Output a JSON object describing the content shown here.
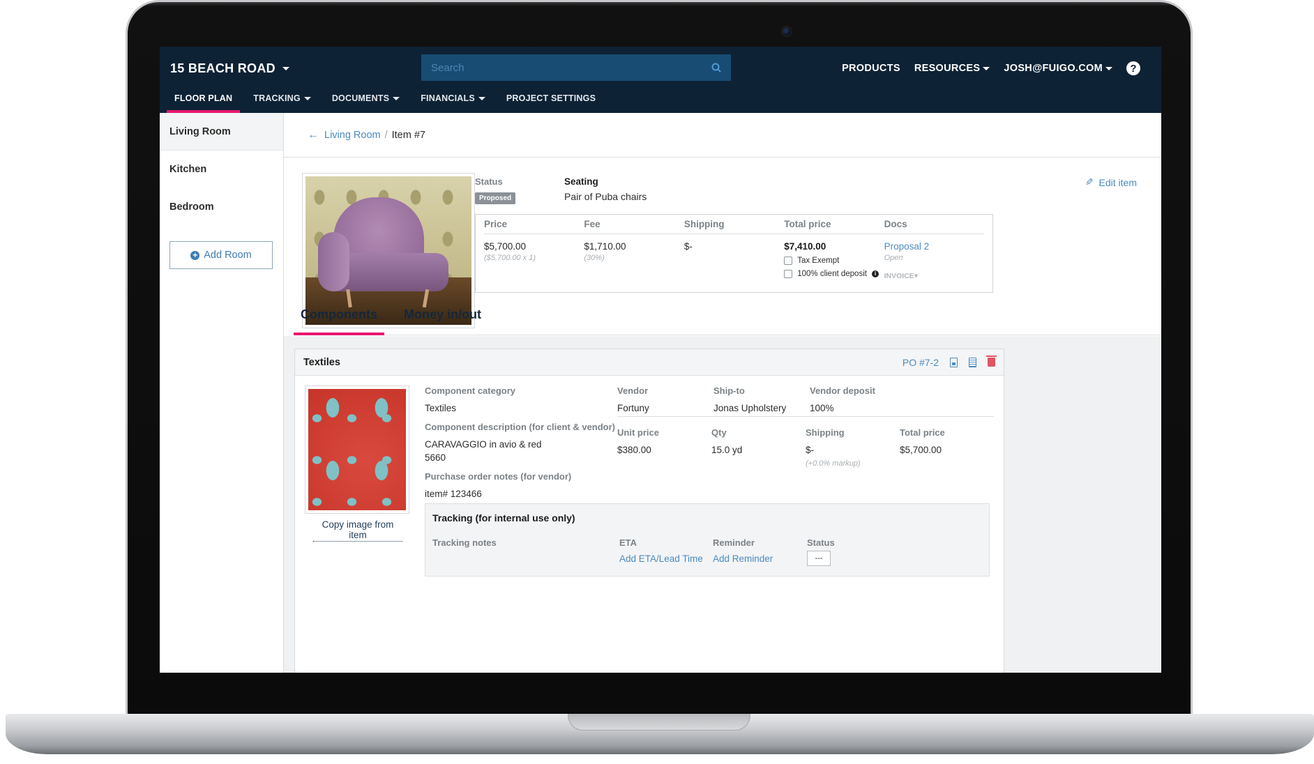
{
  "app": {
    "project_name": "15 BEACH ROAD",
    "search_placeholder": "Search",
    "top_nav": [
      "PRODUCTS",
      "RESOURCES",
      "JOSH@FUIGO.COM"
    ],
    "help": "?"
  },
  "subnav": {
    "tabs": [
      "FLOOR PLAN",
      "TRACKING",
      "DOCUMENTS",
      "FINANCIALS",
      "PROJECT SETTINGS"
    ],
    "active": "FLOOR PLAN"
  },
  "sidebar": {
    "rooms": [
      "Living Room",
      "Kitchen",
      "Bedroom"
    ],
    "active_room": "Living Room",
    "add_room": "Add Room"
  },
  "breadcrumb": {
    "parent": "Living Room",
    "sep": "/",
    "current": "Item #7"
  },
  "item": {
    "status_label": "Status",
    "status_value": "Proposed",
    "category": "Seating",
    "description": "Pair of Puba chairs",
    "edit": "Edit item"
  },
  "pricing": {
    "headers": [
      "Price",
      "Fee",
      "Shipping",
      "Total price",
      "Docs"
    ],
    "price": "$5,700.00",
    "price_sub": "($5,700.00 x 1)",
    "fee": "$1,710.00",
    "fee_sub": "(30%)",
    "shipping": "$-",
    "total": "$7,410.00",
    "tax_exempt": "Tax Exempt",
    "client_deposit": "100% client deposit",
    "proposal": "Proposal 2",
    "proposal_status": "Open",
    "invoice": "INVOICE"
  },
  "tabs": [
    "Components",
    "Money in/out"
  ],
  "component": {
    "title": "Textiles",
    "po": "PO #7-2",
    "copy_image": "Copy image from item",
    "category_label": "Component category",
    "category_value": "Textiles",
    "desc_label": "Component description (for client & vendor)",
    "desc_line1": "CARAVAGGIO in avio & red",
    "desc_line2": "5660",
    "po_notes_label": "Purchase order notes (for vendor)",
    "po_notes_value": "item# 123466",
    "vendor_label": "Vendor",
    "vendor_value": "Fortuny",
    "shipto_label": "Ship-to",
    "shipto_value": "Jonas Upholstery",
    "deposit_label": "Vendor deposit",
    "deposit_value": "100%",
    "unit_label": "Unit price",
    "unit_value": "$380.00",
    "qty_label": "Qty",
    "qty_value": "15.0  yd",
    "shipping_label": "Shipping",
    "shipping_value": "$-",
    "shipping_sub": "(+0.0% markup)",
    "total_label": "Total price",
    "total_value": "$5,700.00"
  },
  "tracking": {
    "title": "Tracking (for internal use only)",
    "notes_label": "Tracking notes",
    "eta_label": "ETA",
    "eta_link": "Add ETA/Lead Time",
    "reminder_label": "Reminder",
    "reminder_link": "Add Reminder",
    "status_label": "Status",
    "status_value": "---"
  },
  "colors": {
    "navy": "#0e2235",
    "accent": "#e8176f",
    "link": "#4b8bbf"
  }
}
